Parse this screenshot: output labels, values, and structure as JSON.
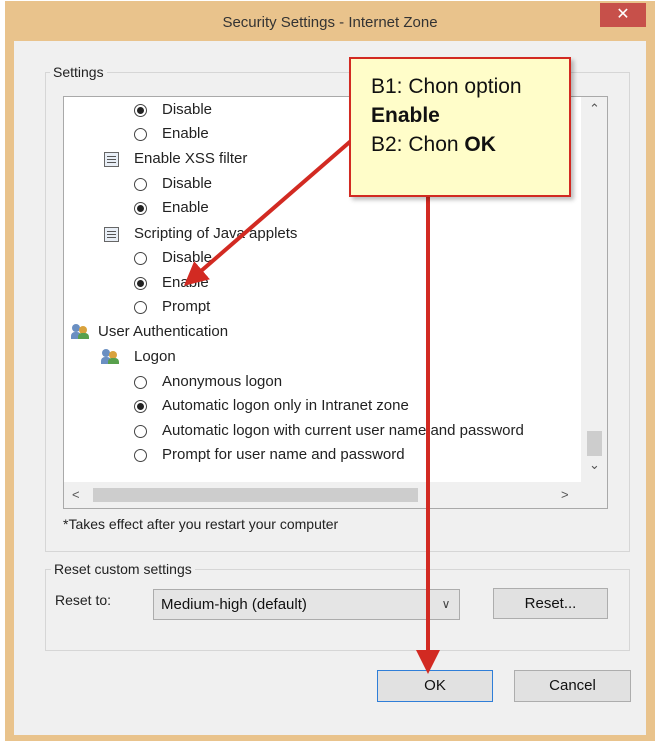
{
  "window": {
    "title": "Security Settings - Internet Zone",
    "close_glyph": "✕"
  },
  "settings_group": {
    "label": "Settings"
  },
  "tree": {
    "r1": {
      "label": "Disable",
      "checked": true
    },
    "r2": {
      "label": "Enable",
      "checked": false
    },
    "h1": {
      "label": "Enable XSS filter",
      "icon": "settings-doc-icon"
    },
    "r3": {
      "label": "Disable",
      "checked": false
    },
    "r4": {
      "label": "Enable",
      "checked": true
    },
    "h2": {
      "label": "Scripting of Java applets",
      "icon": "settings-doc-icon"
    },
    "r5": {
      "label": "Disable",
      "checked": false
    },
    "r6": {
      "label": "Enable",
      "checked": true
    },
    "r7": {
      "label": "Prompt",
      "checked": false
    },
    "h3": {
      "label": "User Authentication",
      "icon": "users-icon"
    },
    "h4": {
      "label": "Logon",
      "icon": "users-icon"
    },
    "r8": {
      "label": "Anonymous logon",
      "checked": false
    },
    "r9": {
      "label": "Automatic logon only in Intranet zone",
      "checked": true
    },
    "r10": {
      "label": "Automatic logon with current user name and password",
      "checked": false
    },
    "r11": {
      "label": "Prompt for user name and password",
      "checked": false
    }
  },
  "note": "*Takes effect after you restart your computer",
  "reset_group": {
    "label": "Reset custom settings",
    "reset_to_label": "Reset to:",
    "select_value": "Medium-high (default)",
    "reset_button": "Reset..."
  },
  "buttons": {
    "ok": "OK",
    "cancel": "Cancel"
  },
  "annotation": {
    "line1": "B1: Chon option",
    "line2": "Enable",
    "line3_prefix": "B2: Chon ",
    "line3_bold": "OK",
    "color": "#d22a22"
  }
}
